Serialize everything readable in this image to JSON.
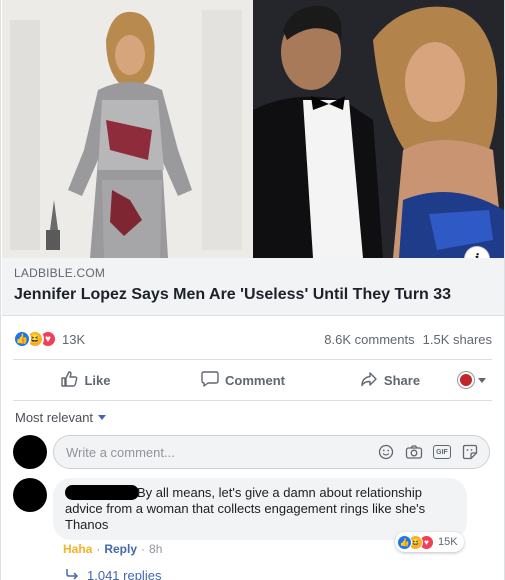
{
  "link": {
    "domain": "LADBIBLE.COM",
    "headline": "Jennifer Lopez Says Men Are 'Useless' Until They Turn 33",
    "info_glyph": "i"
  },
  "summary": {
    "reaction_count": "13K",
    "comments": "8.6K comments",
    "shares": "1.5K shares"
  },
  "actions": {
    "like": "Like",
    "comment": "Comment",
    "share": "Share"
  },
  "comments": {
    "sort_label": "Most relevant",
    "composer_placeholder": "Write a comment...",
    "gif_label": "GIF",
    "top_comment": {
      "text": "By all means, let's give a damn about relationship advice from a woman that collects engagement rings like she's Thanos",
      "reaction_count": "15K",
      "reaction": "Haha",
      "reply": "Reply",
      "time": "8h",
      "separator": "·"
    },
    "replies_label": "1,041 replies"
  },
  "colors": {
    "like_blue": "#1877f2",
    "haha_yellow": "#f7b125",
    "love_red": "#f33e58",
    "link_blue": "#4267b2"
  }
}
